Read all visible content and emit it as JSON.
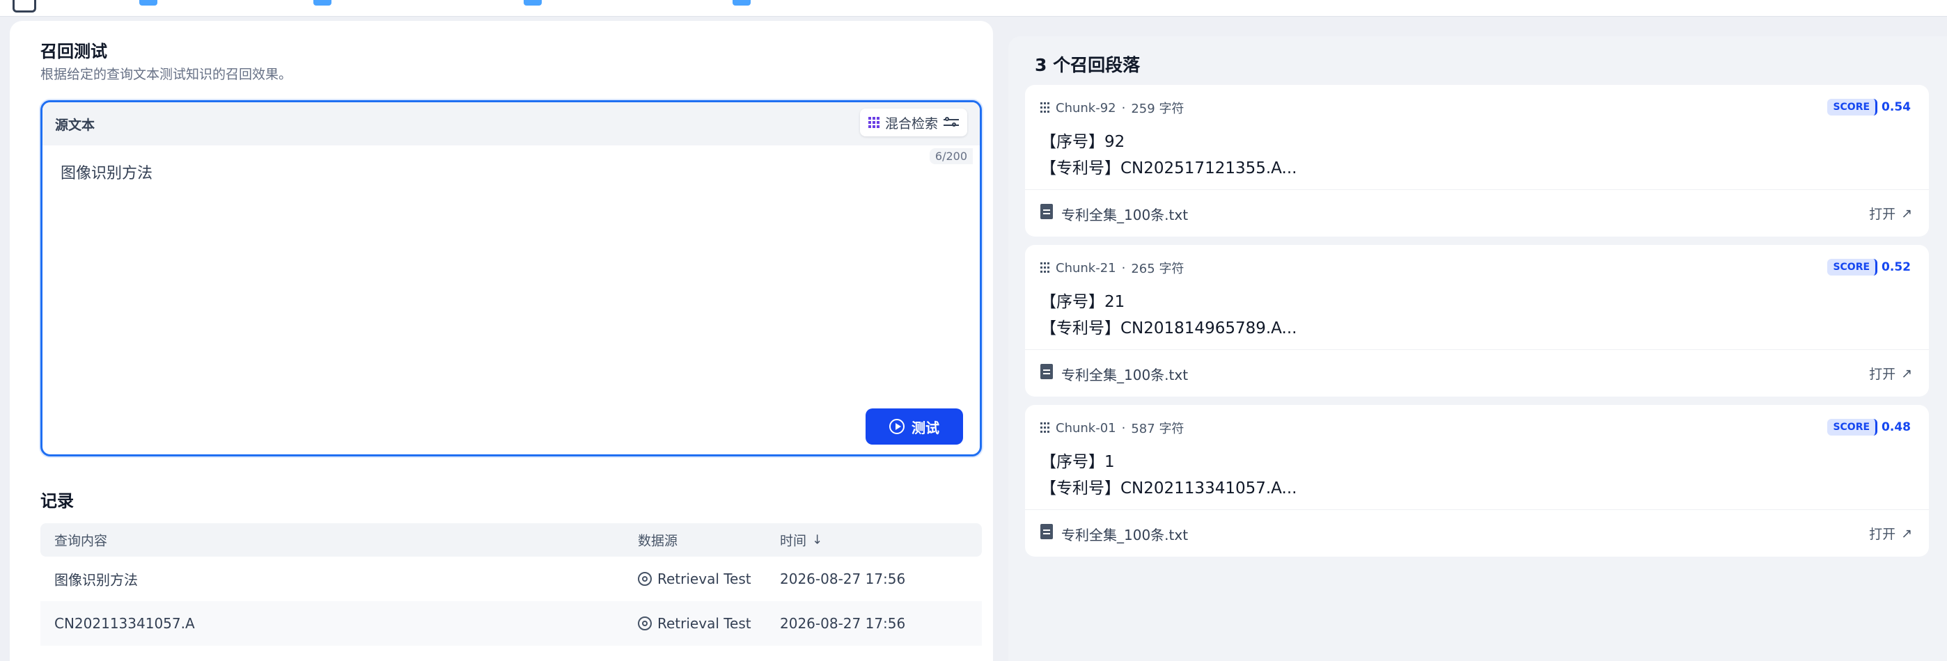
{
  "left": {
    "title": "召回测试",
    "subtitle": "根据给定的查询文本测试知识的召回效果。",
    "editor": {
      "label": "源文本",
      "mode": "混合检索",
      "counter": "6/200",
      "query": "图像识别方法",
      "test_button": "测试"
    },
    "records": {
      "title": "记录",
      "headers": [
        "查询内容",
        "数据源",
        "时间"
      ],
      "rows": [
        {
          "query": "图像识别方法",
          "source": "Retrieval Test",
          "time": "2026-08-27 17:56"
        },
        {
          "query": "CN202113341057.A",
          "source": "Retrieval Test",
          "time": "2026-08-27 17:56"
        }
      ]
    }
  },
  "right": {
    "title": "3 个召回段落",
    "chunks": [
      {
        "id": "Chunk-92",
        "chars": "259 字符",
        "score_label": "SCORE",
        "score": "0.54",
        "line1": "【序号】92",
        "line2": "【专利号】CN202517121355.A...",
        "file": "专利全集_100条.txt",
        "open": "打开"
      },
      {
        "id": "Chunk-21",
        "chars": "265 字符",
        "score_label": "SCORE",
        "score": "0.52",
        "line1": "【序号】21",
        "line2": "【专利号】CN201814965789.A...",
        "file": "专利全集_100条.txt",
        "open": "打开"
      },
      {
        "id": "Chunk-01",
        "chars": "587 字符",
        "score_label": "SCORE",
        "score": "0.48",
        "line1": "【序号】1",
        "line2": "【专利号】CN202113341057.A...",
        "file": "专利全集_100条.txt",
        "open": "打开"
      }
    ]
  },
  "colors": {
    "accent": "#1547f0",
    "editor_border": "#1f6ff2",
    "mode_icon": "#6b3fe4"
  },
  "icons": {
    "menu": "menu-icon",
    "mode": "grid-icon",
    "settings": "sliders-icon",
    "play": "play-circle-icon",
    "source": "target-icon",
    "sort": "arrow-down-icon",
    "chunk": "dots-icon",
    "file": "document-icon",
    "open": "external-link-icon"
  }
}
